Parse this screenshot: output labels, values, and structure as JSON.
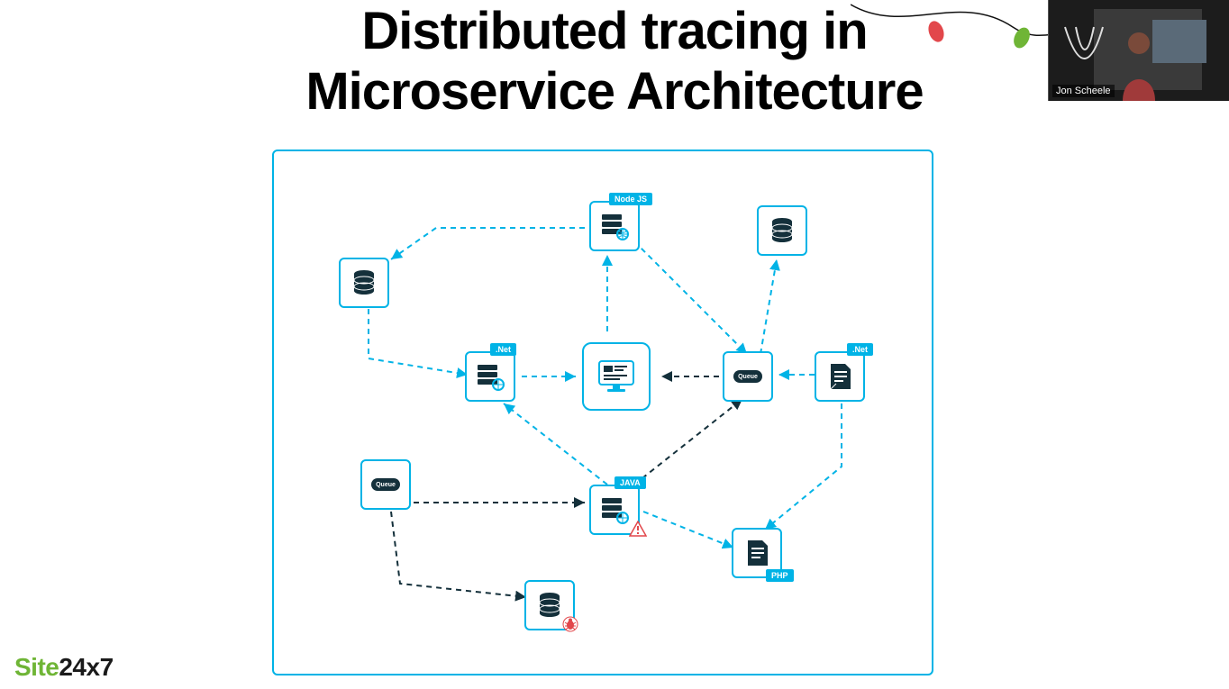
{
  "title_line1": "Distributed tracing in",
  "title_line2": "Microservice Architecture",
  "logo": {
    "part1": "Site",
    "part2": "24x7"
  },
  "overlay": {
    "speaker_name": "Jon Scheele"
  },
  "nodes": {
    "nodejs": {
      "label": "Node JS"
    },
    "net1": {
      "label": ".Net"
    },
    "net2": {
      "label": ".Net"
    },
    "java": {
      "label": "JAVA"
    },
    "php": {
      "label": "PHP"
    },
    "queue1": {
      "pill": "Queue"
    },
    "queue2": {
      "pill": "Queue"
    }
  },
  "diagram": {
    "description": "Microservice map: central web client connected via dashed request arrows to Node JS, .Net, Java services; services connect to databases, queues, config files; Java node flagged with alert; PHP file node; one DB flagged with bug.",
    "accent_color": "#00b3e6",
    "dark_fill": "#14303b",
    "error_color": "#e2474b"
  }
}
